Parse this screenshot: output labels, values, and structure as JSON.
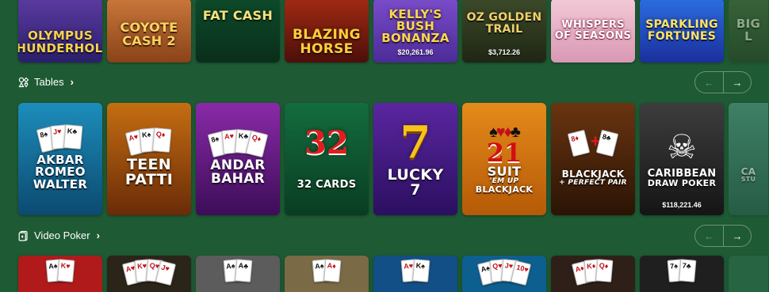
{
  "row_slots": {
    "tiles": [
      {
        "title": "OLYMPUS THUNDERHOLD",
        "bg": "#5b3aa0"
      },
      {
        "title": "COYOTE CASH 2",
        "bg": "#c9773a"
      },
      {
        "title": "FAT CASH",
        "bg": "#0d4a2a"
      },
      {
        "title": "BLAZING HORSE",
        "bg": "#a12a12"
      },
      {
        "title": "KELLY'S BUSH BONANZA",
        "bg": "#7a4cc9",
        "jackpot": "$20,261.96"
      },
      {
        "title": "OZ GOLDEN TRAIL",
        "bg": "#3d4a2a",
        "jackpot": "$3,712.26"
      },
      {
        "title": "WHISPERS OF SEASONS",
        "bg": "#f3c9d6"
      },
      {
        "title": "SPARKLING FORTUNES",
        "bg": "#2b6de0"
      },
      {
        "title": "BIG L",
        "bg": "#4e6a3d"
      }
    ]
  },
  "tables": {
    "header_label": "Tables",
    "header_icon": "tables-icon",
    "prev_label": "←",
    "next_label": "→",
    "tiles": [
      {
        "line1": "AKBAR",
        "line2": "ROMEO",
        "line3": "WALTER"
      },
      {
        "line1": "TEEN",
        "line2": "PATTI"
      },
      {
        "line1": "ANDAR",
        "line2": "BAHAR"
      },
      {
        "number": "32",
        "line1": "32 CARDS"
      },
      {
        "number": "7",
        "line1": "LUCKY",
        "line2": "7"
      },
      {
        "number": "21",
        "line1": "SUIT",
        "line2": "'EM UP",
        "line3": "BLACKJACK"
      },
      {
        "line1": "BLACKJACK",
        "line2": "+ PERFECT PAIR"
      },
      {
        "line1": "CARIBBEAN",
        "line2": "DRAW POKER",
        "jackpot": "$118,221.46"
      },
      {
        "line1": "CA",
        "line2": "STU"
      }
    ]
  },
  "video_poker": {
    "header_label": "Video Poker",
    "header_icon": "video-poker-icon",
    "prev_label": "←",
    "next_label": "→",
    "tiles": [
      {
        "cards": [
          "A",
          "K"
        ]
      },
      {
        "cards": [
          "A",
          "K",
          "Q",
          "J"
        ]
      },
      {
        "cards": [
          "A",
          "A"
        ]
      },
      {
        "cards": [
          "A",
          "A"
        ]
      },
      {
        "cards": [
          "A",
          "K"
        ]
      },
      {
        "cards": [
          "A",
          "Q",
          "J",
          "10"
        ]
      },
      {
        "cards": [
          "A",
          "K",
          "Q"
        ]
      },
      {
        "cards": [
          "7",
          "7"
        ]
      },
      {
        "cards": []
      }
    ]
  }
}
